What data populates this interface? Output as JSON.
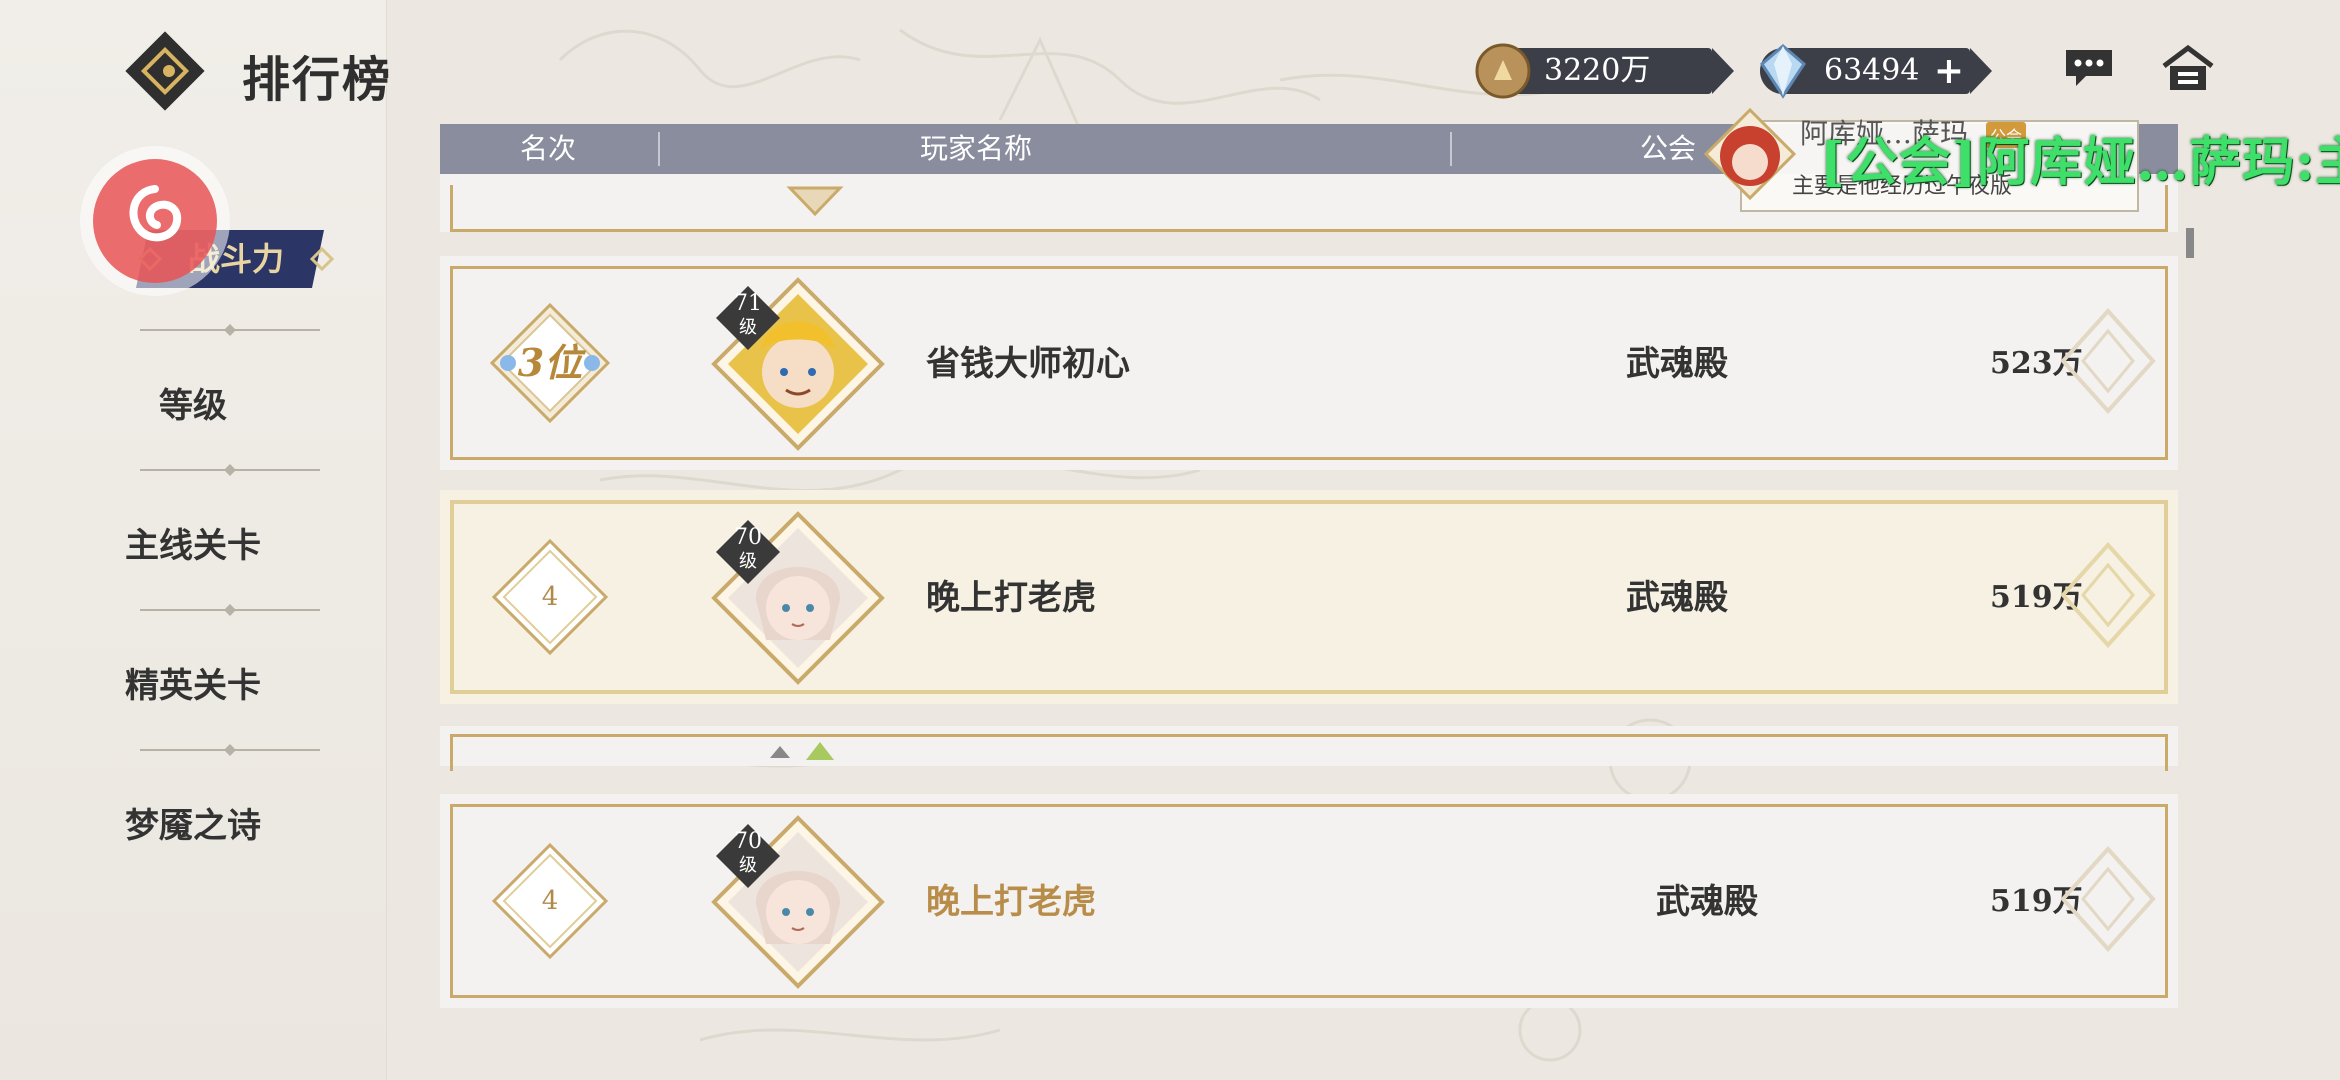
{
  "header": {
    "title": "排行榜",
    "coin_value": "3220万",
    "gem_value": "63494",
    "plus_label": "+"
  },
  "sidebar": {
    "active": "战斗力",
    "items": [
      "等级",
      "主线关卡",
      "精英关卡",
      "梦魇之诗"
    ]
  },
  "table": {
    "columns": [
      "名次",
      "玩家名称",
      "公会"
    ],
    "rows": [
      {
        "rank": "3位",
        "level": "71",
        "level_unit": "级",
        "name": "省钱大师初心",
        "guild": "武魂殿",
        "power": "523万"
      },
      {
        "rank": "4",
        "level": "70",
        "level_unit": "级",
        "name": "晚上打老虎",
        "guild": "武魂殿",
        "power": "519万"
      }
    ],
    "self_row": {
      "rank": "4",
      "level": "70",
      "level_unit": "级",
      "name": "晚上打老虎",
      "guild": "武魂殿",
      "power": "519万"
    }
  },
  "chat_popup": {
    "sender": "阿库娅…萨玛",
    "tag": "公会",
    "message": "主要是他经历过午夜版",
    "danmaku": "[公会]阿库娅…萨玛:主要"
  },
  "colors": {
    "accent_gold": "#c9aa6a",
    "header_bar": "#8a8d9d",
    "danmaku_green": "#3fe06a",
    "active_tab": "#2b3566"
  }
}
